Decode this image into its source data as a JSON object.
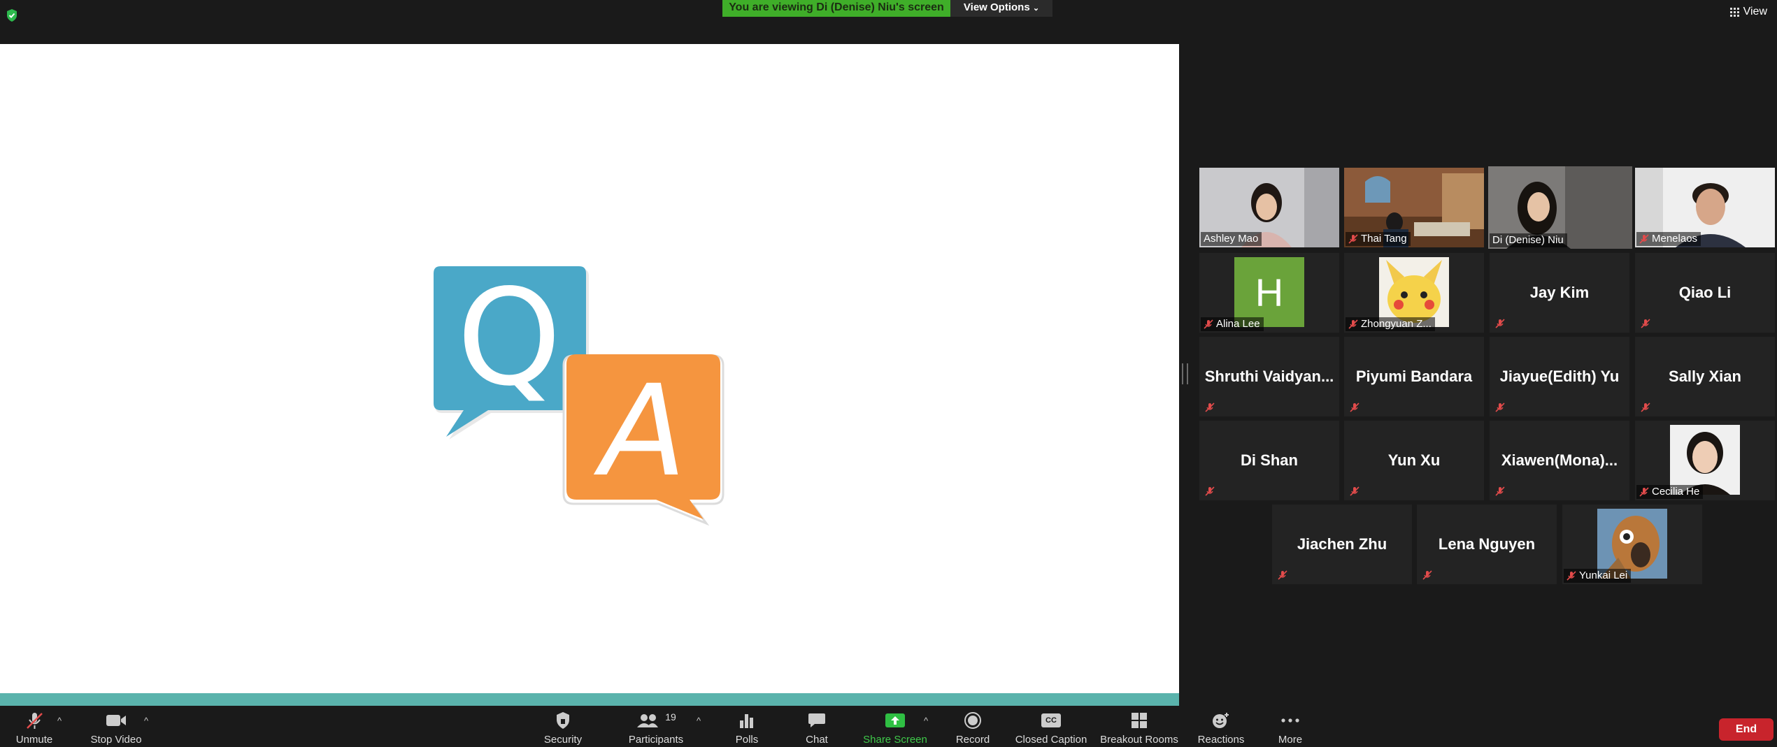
{
  "topbar": {
    "banner_text": "You are viewing Di (Denise)  Niu's screen",
    "view_options_label": "View Options",
    "view_label": "View"
  },
  "shared_screen": {
    "banner_color": "#3fae29",
    "q_letter": "Q",
    "a_letter": "A",
    "q_color": "#4aa8c8",
    "a_color": "#f5953f"
  },
  "gallery": {
    "video_tiles": [
      {
        "name": "Ashley Mao"
      },
      {
        "name": "Thai Tang"
      },
      {
        "name": "Di (Denise)  Niu"
      },
      {
        "name": "Menelaos"
      }
    ],
    "alina": {
      "name": "Alina Lee",
      "avatar_letter": "H"
    },
    "zhongyuan": {
      "name": "Zhongyuan Z..."
    },
    "name_tiles": [
      "Jay Kim",
      "Qiao Li",
      "Shruthi  Vaidyan...",
      "Piyumi Bandara",
      "Jiayue(Edith) Yu",
      "Sally Xian",
      "Di Shan",
      "Yun Xu",
      "Xiawen(Mona)...",
      "Jiachen Zhu",
      "Lena Nguyen"
    ],
    "cecilia": {
      "name": "Cecilia He"
    },
    "yunkai": {
      "name": "Yunkai Lei"
    }
  },
  "toolbar": {
    "unmute": "Unmute",
    "stop_video": "Stop Video",
    "security": "Security",
    "participants": "Participants",
    "participants_count": "19",
    "polls": "Polls",
    "chat": "Chat",
    "share_screen": "Share Screen",
    "record": "Record",
    "closed_caption": "Closed Caption",
    "breakout_rooms": "Breakout Rooms",
    "reactions": "Reactions",
    "more": "More",
    "end": "End",
    "cc_glyph": "CC"
  }
}
